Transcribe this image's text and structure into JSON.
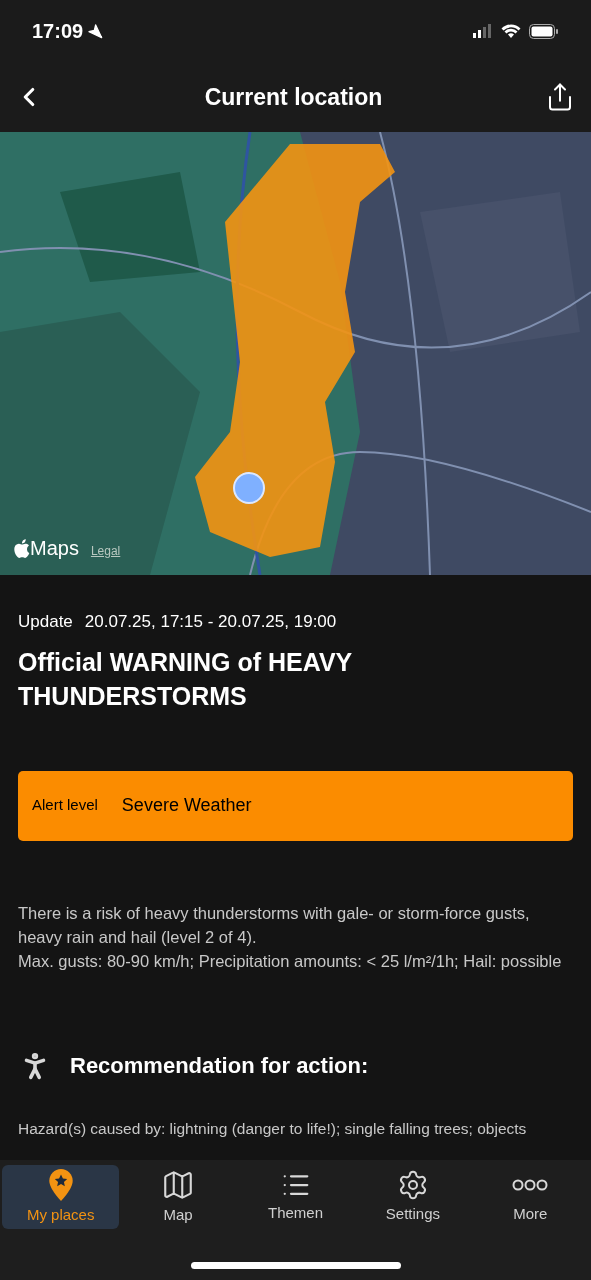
{
  "status_bar": {
    "time": "17:09"
  },
  "nav": {
    "title": "Current location"
  },
  "map": {
    "attribution": "Maps",
    "legal": "Legal"
  },
  "update": {
    "label": "Update",
    "range": "20.07.25, 17:15 - 20.07.25, 19:00"
  },
  "headline": "Official WARNING of HEAVY THUNDERSTORMS",
  "alert": {
    "label": "Alert level",
    "value": "Severe Weather",
    "color": "#fb8c00"
  },
  "description": "There is a risk of heavy thunderstorms with gale- or storm-force gusts, heavy rain and hail (level 2 of 4).\nMax. gusts: 80-90 km/h; Precipitation amounts: < 25 l/m²/1h; Hail: possible",
  "recommendation": {
    "title": "Recommendation for action:",
    "text": "Hazard(s) caused by: lightning (danger to life!); single falling trees; objects"
  },
  "tabs": [
    {
      "kind": "places",
      "label": "My places",
      "selected": true
    },
    {
      "kind": "map",
      "label": "Map",
      "selected": false
    },
    {
      "kind": "list",
      "label": "Themen",
      "selected": false
    },
    {
      "kind": "settings",
      "label": "Settings",
      "selected": false
    },
    {
      "kind": "more",
      "label": "More",
      "selected": false
    }
  ]
}
